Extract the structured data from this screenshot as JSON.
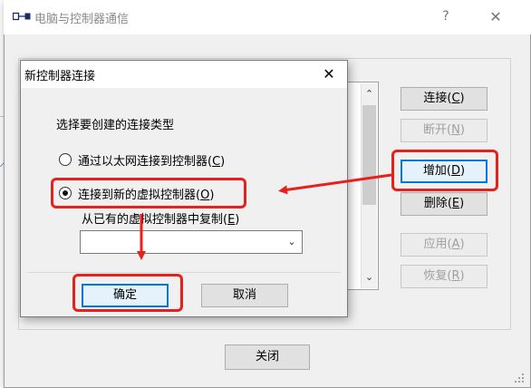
{
  "outer_dialog": {
    "title": "电脑与控制器通信",
    "help_label": "?",
    "close_label": "✕",
    "buttons": {
      "connect": {
        "text": "连接(",
        "key": "C",
        "tail": ")"
      },
      "disconnect": {
        "text": "断开(",
        "key": "N",
        "tail": ")"
      },
      "add": {
        "text": "增加(",
        "key": "D",
        "tail": ")"
      },
      "delete": {
        "text": "删除(",
        "key": "E",
        "tail": ")"
      },
      "apply": {
        "text": "应用(",
        "key": "A",
        "tail": ")"
      },
      "restore": {
        "text": "恢复(",
        "key": "R",
        "tail": ")"
      }
    },
    "close_button": "关闭"
  },
  "modal": {
    "title": "新控制器连接",
    "close_label": "✕",
    "prompt": "选择要创建的连接类型",
    "options": [
      {
        "label": "通过以太网连接到控制器(",
        "key": "C",
        "tail": ")",
        "checked": false
      },
      {
        "label": "连接到新的虚拟控制器(",
        "key": "O",
        "tail": ")",
        "checked": true
      }
    ],
    "copy_label": {
      "text": "从已有的虚拟控制器中复制(",
      "key": "E",
      "tail": ")"
    },
    "select_value": "",
    "ok_button": "确定",
    "cancel_button": "取消"
  },
  "colors": {
    "highlight": "#e8201c",
    "focus": "#0078d7",
    "dialog_bg": "#f0f0f0"
  }
}
